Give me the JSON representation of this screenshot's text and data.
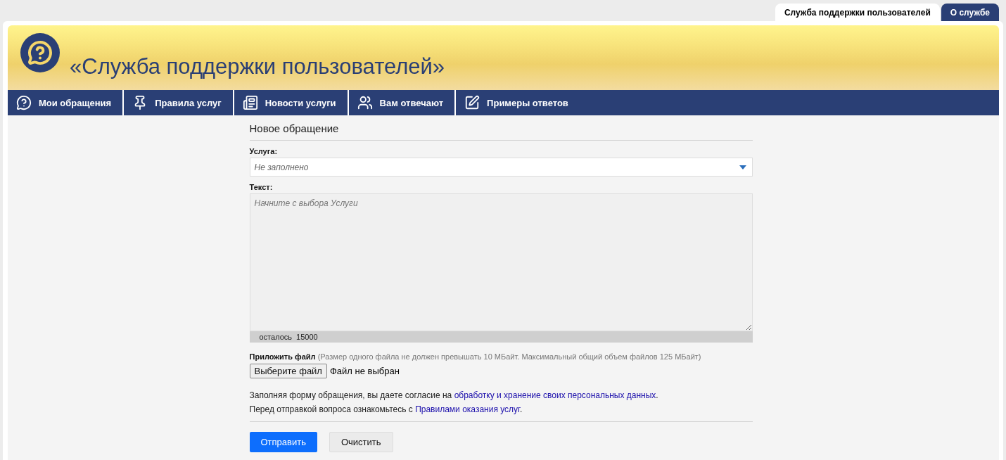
{
  "top_tabs": [
    {
      "label": "Служба поддержки пользователей",
      "selected": true
    },
    {
      "label": "О службе",
      "selected": false
    }
  ],
  "header": {
    "title": "«Служба поддержки пользователей»"
  },
  "nav": [
    {
      "label": "Мои обращения"
    },
    {
      "label": "Правила услуг"
    },
    {
      "label": "Новости услуги"
    },
    {
      "label": "Вам отвечают"
    },
    {
      "label": "Примеры ответов"
    }
  ],
  "form": {
    "title": "Новое обращение",
    "service": {
      "label": "Услуга:",
      "placeholder": "Не заполнено"
    },
    "text": {
      "label": "Текст:",
      "placeholder": "Начните с выбора Услуги",
      "counter_label": "осталось",
      "counter_value": "15000"
    },
    "attach": {
      "label": "Приложить файл",
      "hint": "(Размер одного файла не должен превышать 10 МБайт. Максимальный общий объем файлов 125 МБайт)",
      "button": "Выберите файл",
      "status": "Файл не выбран"
    },
    "notes": [
      {
        "text": "Заполняя форму обращения, вы даете согласие на ",
        "link": "обработку и хранение своих персональных данных",
        "end": "."
      },
      {
        "text": "Перед отправкой вопроса ознакомьтесь с ",
        "link": "Правилами оказания услуг",
        "end": "."
      }
    ],
    "buttons": [
      {
        "label": "Отправить",
        "kind": "primary"
      },
      {
        "label": "Очистить",
        "kind": "secondary"
      }
    ]
  }
}
